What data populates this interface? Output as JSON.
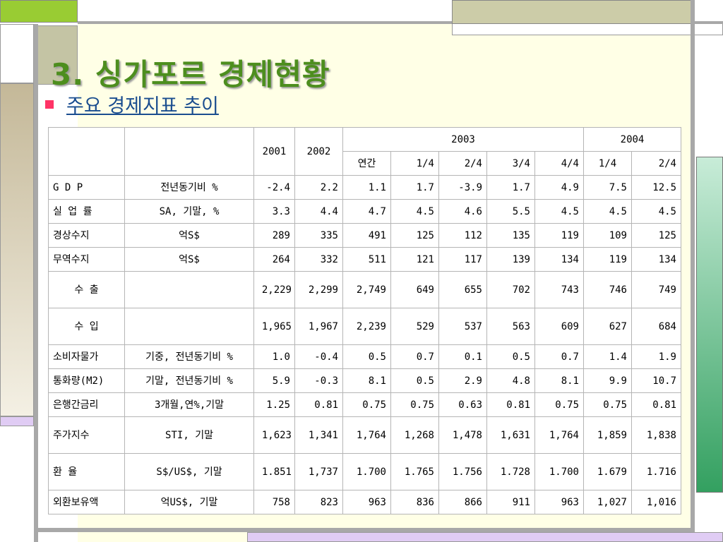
{
  "slide": {
    "title": "3. 싱가포르 경제현황",
    "subtitle": "주요 경제지표 추이"
  },
  "table": {
    "years": [
      "2001",
      "2002",
      "2003",
      "2004"
    ],
    "subheaders": [
      "연간",
      "1/4",
      "2/4",
      "3/4",
      "4/4",
      "1/4",
      "2/4"
    ],
    "rows": [
      {
        "name": "G D P",
        "unit": "전년동기비 %",
        "values": [
          "-2.4",
          "2.2",
          "1.1",
          "1.7",
          "-3.9",
          "1.7",
          "4.9",
          "7.5",
          "12.5"
        ]
      },
      {
        "name": "실 업 률",
        "unit": "SA, 기말, %",
        "values": [
          "3.3",
          "4.4",
          "4.7",
          "4.5",
          "4.6",
          "5.5",
          "4.5",
          "4.5",
          "4.5"
        ]
      },
      {
        "name": "경상수지",
        "unit": "억S$",
        "values": [
          "289",
          "335",
          "491",
          "125",
          "112",
          "135",
          "119",
          "109",
          "125"
        ]
      },
      {
        "name": "무역수지",
        "unit": "억S$",
        "values": [
          "264",
          "332",
          "511",
          "121",
          "117",
          "139",
          "134",
          "119",
          "134"
        ]
      },
      {
        "name": "수 출",
        "unit": "",
        "values": [
          "2,229",
          "2,299",
          "2,749",
          "649",
          "655",
          "702",
          "743",
          "746",
          "749"
        ]
      },
      {
        "name": "수 입",
        "unit": "",
        "values": [
          "1,965",
          "1,967",
          "2,239",
          "529",
          "537",
          "563",
          "609",
          "627",
          "684"
        ]
      },
      {
        "name": "소비자물가",
        "unit": "기중, 전년동기비 %",
        "values": [
          "1.0",
          "-0.4",
          "0.5",
          "0.7",
          "0.1",
          "0.5",
          "0.7",
          "1.4",
          "1.9"
        ]
      },
      {
        "name": "통화량(M2)",
        "unit": "기말, 전년동기비 %",
        "values": [
          "5.9",
          "-0.3",
          "8.1",
          "0.5",
          "2.9",
          "4.8",
          "8.1",
          "9.9",
          "10.7"
        ]
      },
      {
        "name": "은행간금리",
        "unit": "3개월,연%,기말",
        "values": [
          "1.25",
          "0.81",
          "0.75",
          "0.75",
          "0.63",
          "0.81",
          "0.75",
          "0.75",
          "0.81"
        ]
      },
      {
        "name": "주가지수",
        "unit": "STI, 기말",
        "values": [
          "1,623",
          "1,341",
          "1,764",
          "1,268",
          "1,478",
          "1,631",
          "1,764",
          "1,859",
          "1,838"
        ]
      },
      {
        "name": "환 율",
        "unit": "S$/US$, 기말",
        "values": [
          "1.851",
          "1,737",
          "1.700",
          "1.765",
          "1.756",
          "1.728",
          "1.700",
          "1.679",
          "1.716"
        ]
      },
      {
        "name": "외환보유액",
        "unit": "억US$, 기말",
        "values": [
          "758",
          "823",
          "963",
          "836",
          "866",
          "911",
          "963",
          "1,027",
          "1,016"
        ]
      }
    ]
  },
  "colors": {
    "title": "#4d8e1e",
    "subtitle": "#1a4d8f",
    "bullet": "#ff3366",
    "background": "#ffffe6"
  }
}
